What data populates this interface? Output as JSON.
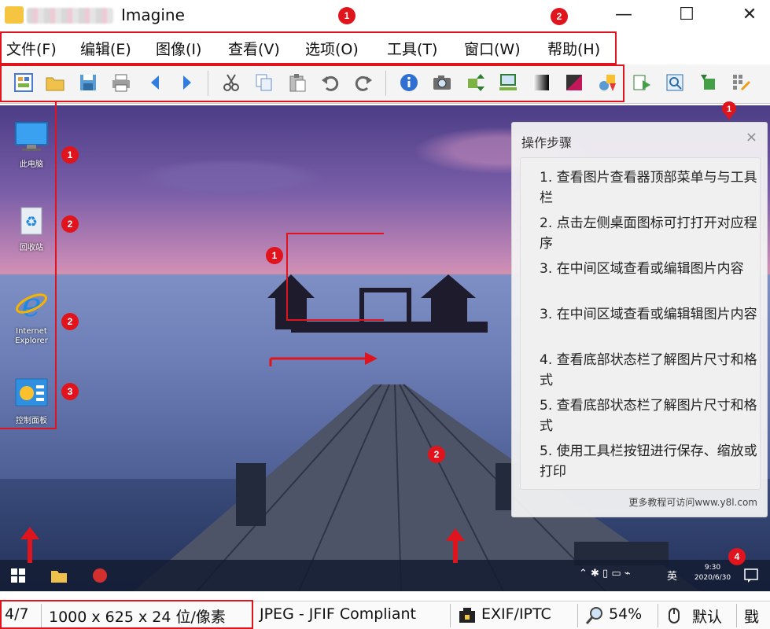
{
  "window": {
    "title": "Imagine",
    "minimize": "—",
    "maximize": "☐",
    "close": "✕"
  },
  "menu": [
    "文件(F)",
    "编辑(E)",
    "图像(I)",
    "查看(V)",
    "选项(O)",
    "工具(T)",
    "窗口(W)",
    "帮助(H)"
  ],
  "toolbar": {
    "icons": [
      "thumbnail-icon",
      "open-folder-icon",
      "save-icon",
      "print-icon",
      "prev-icon",
      "next-icon",
      "cut-icon",
      "copy-icon",
      "paste-icon",
      "undo-icon",
      "redo-icon",
      "info-icon",
      "camera-icon",
      "resize-icon",
      "monitor-icon",
      "gradient-icon",
      "color-icon",
      "effects-icon",
      "download-icon",
      "zoom-icon",
      "rotate-icon",
      "grid-icon"
    ]
  },
  "desktop": {
    "icons": [
      {
        "label": "此电脑",
        "name": "this-pc"
      },
      {
        "label": "回收站",
        "name": "recycle-bin"
      },
      {
        "label": "Internet Explorer",
        "name": "internet-explorer"
      },
      {
        "label": "控制面板",
        "name": "control-panel"
      }
    ]
  },
  "taskbar": {
    "time": "9:30",
    "date": "2020/6/30",
    "ime": "英"
  },
  "steps_panel": {
    "title": "操作步骤",
    "close": "×",
    "steps": [
      "1. 查看图片查看器顶部菜单与与工具栏",
      "2. 点击左侧桌面图标可打打开对应程序",
      "3. 在中间区域查看或编辑图片内容",
      "3. 在中间区域查看或编辑辑图片内容",
      "4. 查看底部状态栏了解图片尺寸和格式",
      "5. 查看底部状态栏了解图片尺寸和格式",
      "5. 使用工具栏按钮进行保存、缩放或打印"
    ],
    "footer": "更多教程可访问www.y8l.com"
  },
  "statusbar": {
    "index": "4/7",
    "dimensions": "1000 x 625 x 24 位/像素",
    "format": "JPEG - JFIF Compliant",
    "meta": "EXIF/IPTC",
    "zoom": "54%",
    "mode": "默认",
    "extra": "戥"
  },
  "badges": [
    "1",
    "2",
    "1",
    "1",
    "2",
    "2",
    "3",
    "1",
    "2",
    "4"
  ],
  "colors": {
    "annotation": "#e0141c"
  }
}
